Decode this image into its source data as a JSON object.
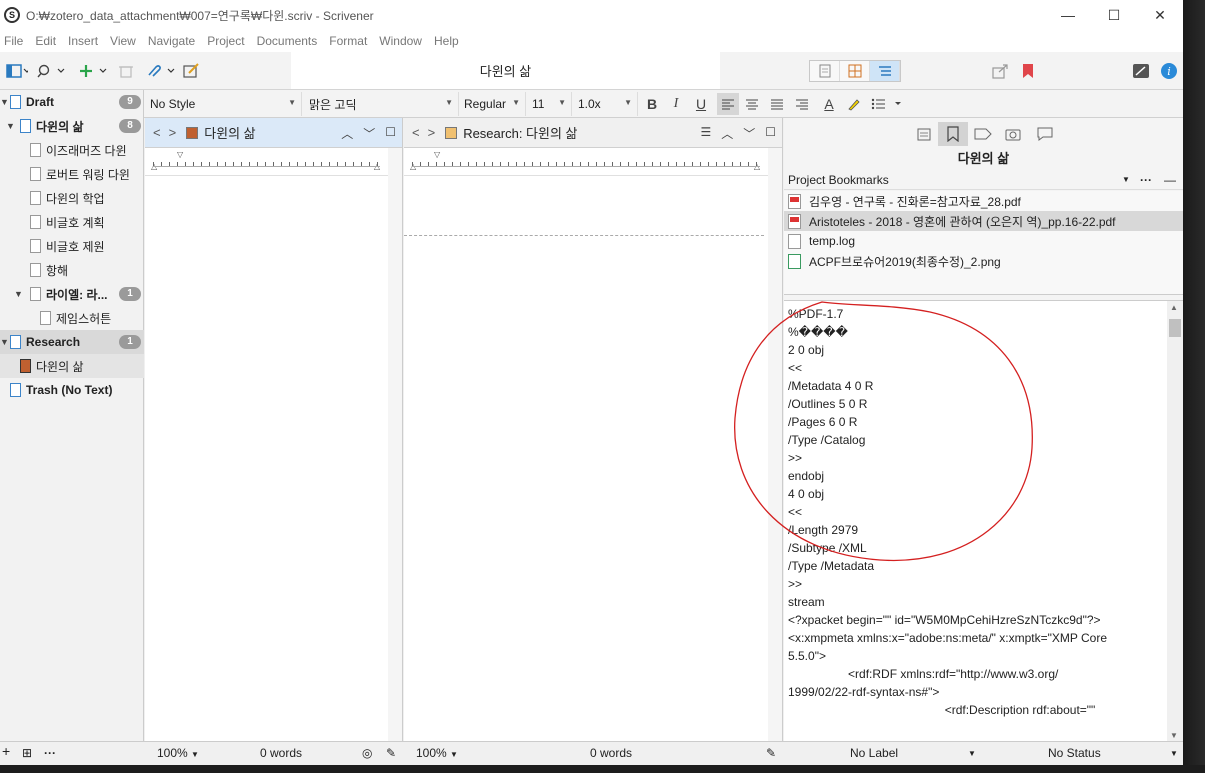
{
  "window": {
    "title": "O:₩zotero_data_attachment₩007=연구록₩다윈.scriv - Scrivener",
    "app_icon": "S",
    "minimize": "—",
    "maximize": "☐",
    "close": "✕"
  },
  "menu": [
    "File",
    "Edit",
    "Insert",
    "View",
    "Navigate",
    "Project",
    "Documents",
    "Format",
    "Window",
    "Help"
  ],
  "toolbar": {
    "document_title": "다윈의 삶"
  },
  "formatbar": {
    "style": "No Style",
    "font": "맑은 고딕",
    "weight": "Regular",
    "size": "11",
    "line_spacing": "1.0x",
    "bold": "B",
    "italic": "I",
    "underline": "U",
    "text_color": "A"
  },
  "binder": {
    "items": [
      {
        "label": "Draft",
        "badge": "9"
      },
      {
        "label": "다윈의 삶",
        "badge": "8"
      },
      {
        "label": "이즈래머즈 다윈"
      },
      {
        "label": "로버트 워링 다윈"
      },
      {
        "label": "다윈의 학업"
      },
      {
        "label": "비글호 계획"
      },
      {
        "label": "비글호 제원"
      },
      {
        "label": "항해"
      },
      {
        "label": "라이엘: 라...",
        "badge": "1"
      },
      {
        "label": "제임스허튼"
      },
      {
        "label": "Research",
        "badge": "1"
      },
      {
        "label": "다윈의 삶"
      },
      {
        "label": "Trash (No Text)"
      }
    ]
  },
  "editor_left": {
    "title": "다윈의 삶",
    "zoom": "100%",
    "word_count": "0 words"
  },
  "editor_right": {
    "title": "Research: 다윈의 삶",
    "zoom": "100%",
    "word_count": "0 words"
  },
  "inspector": {
    "doc_title": "다윈의 삶",
    "bookmarks_header": "Project Bookmarks",
    "bookmarks": [
      {
        "name": "김우영 - 연구록 - 진화론=참고자료_28.pdf",
        "type": "pdf"
      },
      {
        "name": "Aristoteles - 2018 - 영혼에 관하여 (오은지 역)_pp.16-22.pdf",
        "type": "pdf"
      },
      {
        "name": "temp.log",
        "type": "text"
      },
      {
        "name": "ACPF브로슈어2019(최종수정)_2.png",
        "type": "png"
      }
    ],
    "text_lines": [
      "%PDF-1.7",
      "%����",
      "2 0 obj",
      "<<",
      "/Metadata 4 0 R",
      "/Outlines 5 0 R",
      "/Pages 6 0 R",
      "/Type /Catalog",
      ">>",
      "endobj",
      "4 0 obj",
      "<<",
      "/Length 2979",
      "/Subtype /XML",
      "/Type /Metadata",
      ">>",
      "stream",
      "<?xpacket begin=\"\" id=\"W5M0MpCehiHzreSzNTczkc9d\"?>",
      "<x:xmpmeta xmlns:x=\"adobe:ns:meta/\" x:xmptk=\"XMP Core",
      "5.5.0\">",
      "                  <rdf:RDF xmlns:rdf=\"http://www.w3.org/",
      "1999/02/22-rdf-syntax-ns#\">",
      "                                               <rdf:Description rdf:about=\"\""
    ],
    "label": "No Label",
    "status": "No Status"
  },
  "colors": {
    "accent": "#2a7abf",
    "annotation": "#d42020",
    "bookmark_red": "#e0454a"
  }
}
